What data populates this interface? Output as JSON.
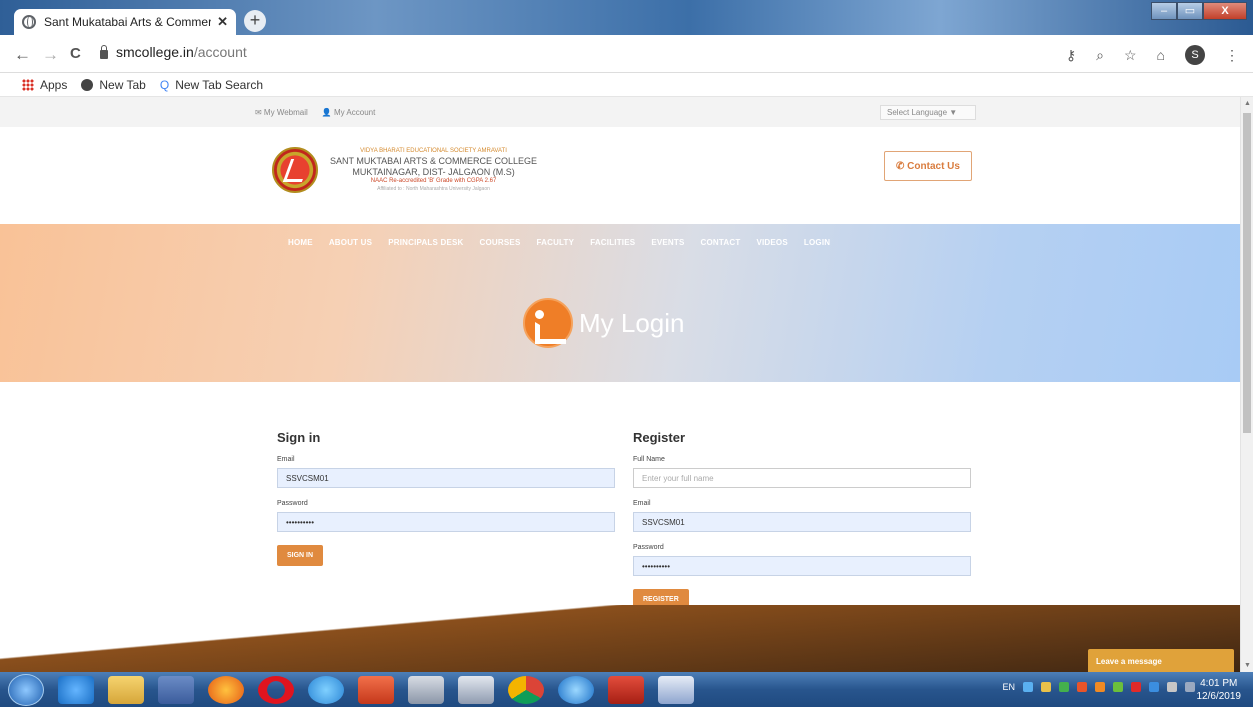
{
  "browser": {
    "tab_title": "Sant Mukatabai Arts & Commerc",
    "tab_close": "✕",
    "new_tab": "+",
    "window_controls": {
      "minimize": "–",
      "maximize": "▭",
      "close": "X"
    },
    "back": "←",
    "forward": "→",
    "reload": "C",
    "url_host": "smcollege.in",
    "url_path": "/account",
    "tools": {
      "key": "⚷",
      "zoom": "⌕",
      "star": "☆",
      "ext": "⌂",
      "profile": "S",
      "menu": "⋮"
    },
    "bookmarks": [
      {
        "label": "Apps",
        "icon": "apps-grid-icon"
      },
      {
        "label": "New Tab",
        "icon": "globe-icon"
      },
      {
        "label": "New Tab Search",
        "icon": "search-icon"
      }
    ]
  },
  "site": {
    "top_links": [
      "✉ My Webmail",
      "👤 My Account"
    ],
    "language": "Select Language   ▼",
    "brand_lines": [
      "VIDYA BHARATI EDUCATIONAL SOCIETY AMRAVATI",
      "SANT MUKTABAI ARTS & COMMERCE COLLEGE",
      "MUKTAINAGAR, DIST- JALGAON (M.S)",
      "NAAC Re-accredited 'B' Grade with CGPA 2.67",
      "Affiliated to : North Maharashtra University Jalgaon"
    ],
    "contact_label": "✆ Contact Us",
    "menu": [
      "HOME",
      "ABOUT US",
      "PRINCIPALS DESK",
      "COURSES",
      "FACULTY",
      "FACILITIES",
      "EVENTS",
      "CONTACT",
      "VIDEOS",
      "LOGIN"
    ],
    "hero_title": "My Login"
  },
  "signin": {
    "heading": "Sign in",
    "email_label": "Email",
    "email_value": "SSVCSM01",
    "password_label": "Password",
    "password_value": "••••••••••",
    "button": "SIGN IN"
  },
  "register": {
    "heading": "Register",
    "fullname_label": "Full Name",
    "fullname_placeholder": "Enter your full name",
    "email_label": "Email",
    "email_value": "SSVCSM01",
    "password_label": "Password",
    "password_value": "••••••••••",
    "button": "REGISTER"
  },
  "chat": {
    "label": "Leave a message"
  },
  "taskbar": {
    "tray_lang": "EN",
    "time": "4:01 PM",
    "date": "12/6/2019"
  },
  "colors": {
    "accent": "#e08a3f",
    "hero_left": "#f9c297",
    "hero_right": "#a8cbf5"
  }
}
